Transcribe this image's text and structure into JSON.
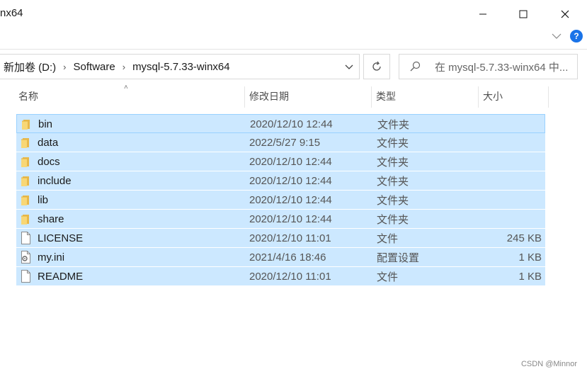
{
  "window": {
    "title": "nx64",
    "minimize_icon": "minimize-icon",
    "maximize_icon": "maximize-icon",
    "close_icon": "close-icon"
  },
  "ribbon": {
    "expand_icon": "chevron-down-icon",
    "help_label": "?"
  },
  "address_bar": {
    "crumbs": [
      "新加卷 (D:)",
      "Software",
      "mysql-5.7.33-winx64"
    ]
  },
  "search": {
    "placeholder": "在 mysql-5.7.33-winx64 中..."
  },
  "columns": {
    "name": "名称",
    "date": "修改日期",
    "type": "类型",
    "size": "大小"
  },
  "files": [
    {
      "name": "bin",
      "date": "2020/12/10 12:44",
      "type": "文件夹",
      "size": "",
      "icon": "folder-icon"
    },
    {
      "name": "data",
      "date": "2022/5/27 9:15",
      "type": "文件夹",
      "size": "",
      "icon": "folder-icon"
    },
    {
      "name": "docs",
      "date": "2020/12/10 12:44",
      "type": "文件夹",
      "size": "",
      "icon": "folder-icon"
    },
    {
      "name": "include",
      "date": "2020/12/10 12:44",
      "type": "文件夹",
      "size": "",
      "icon": "folder-icon"
    },
    {
      "name": "lib",
      "date": "2020/12/10 12:44",
      "type": "文件夹",
      "size": "",
      "icon": "folder-icon"
    },
    {
      "name": "share",
      "date": "2020/12/10 12:44",
      "type": "文件夹",
      "size": "",
      "icon": "folder-icon"
    },
    {
      "name": "LICENSE",
      "date": "2020/12/10 11:01",
      "type": "文件",
      "size": "245 KB",
      "icon": "file-icon"
    },
    {
      "name": "my.ini",
      "date": "2021/4/16 18:46",
      "type": "配置设置",
      "size": "1 KB",
      "icon": "settings-file-icon"
    },
    {
      "name": "README",
      "date": "2020/12/10 11:01",
      "type": "文件",
      "size": "1 KB",
      "icon": "file-icon"
    }
  ],
  "watermark": "CSDN @Minnor",
  "colors": {
    "selection": "#cce8ff",
    "selection_border": "#99d1ff",
    "folder": "#f8d775"
  }
}
